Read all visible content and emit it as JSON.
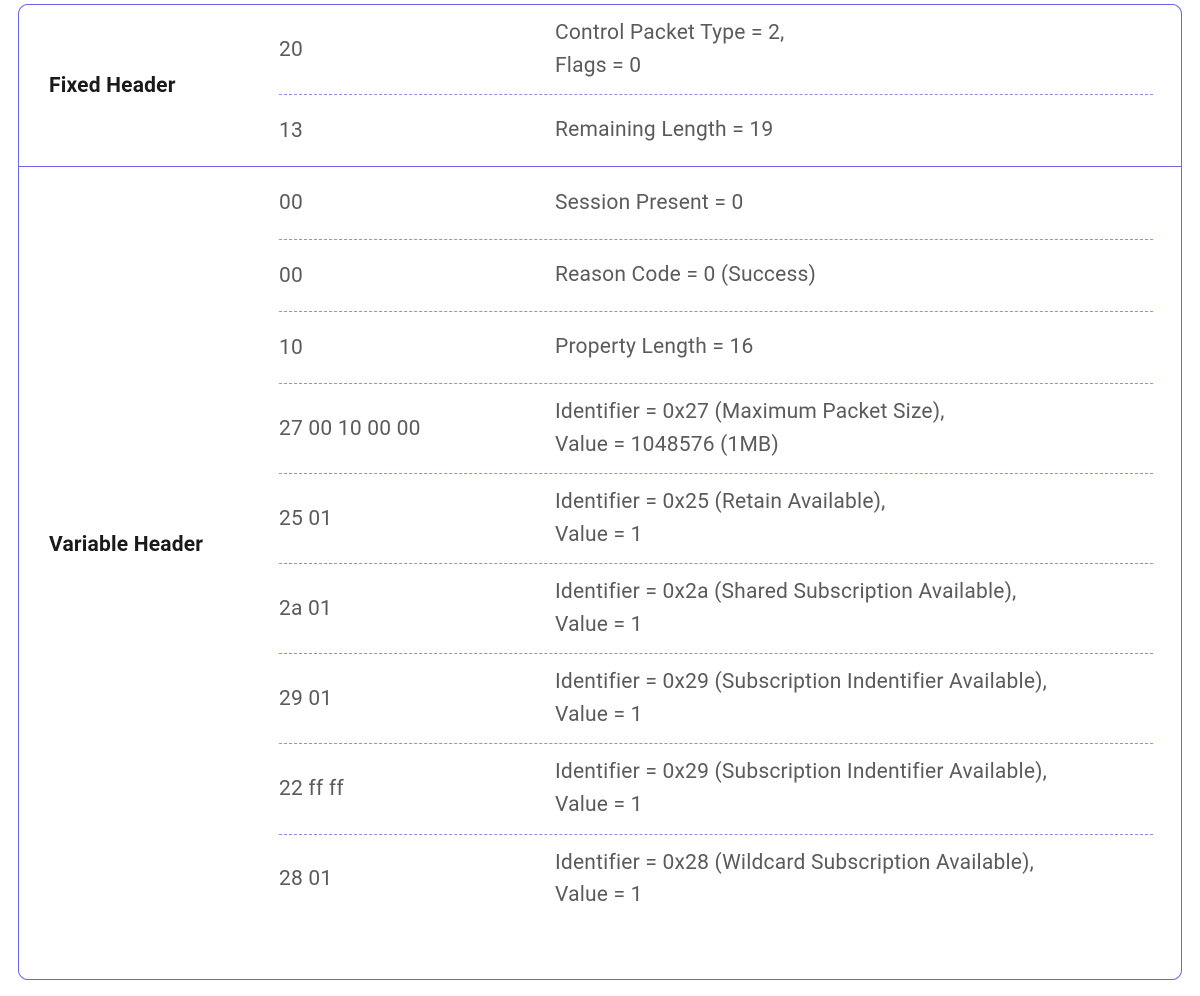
{
  "sections": [
    {
      "label": "Fixed Header",
      "rows": [
        {
          "hex": "20",
          "desc": "Control Packet Type = 2,\nFlags = 0"
        },
        {
          "hex": "13",
          "desc": "Remaining Length = 19"
        }
      ]
    },
    {
      "label": "Variable Header",
      "rows": [
        {
          "hex": "00",
          "desc": "Session Present = 0"
        },
        {
          "hex": "00",
          "desc": "Reason Code = 0 (Success)"
        },
        {
          "hex": "10",
          "desc": "Property Length = 16"
        },
        {
          "hex": "27 00 10 00 00",
          "desc": "Identifier = 0x27 (Maximum Packet Size),\nValue = 1048576 (1MB)"
        },
        {
          "hex": "25 01",
          "desc": "Identifier = 0x25 (Retain Available),\nValue = 1"
        },
        {
          "hex": "2a 01",
          "desc": "Identifier = 0x2a (Shared Subscription Available),\nValue = 1"
        },
        {
          "hex": "29 01",
          "desc": "Identifier = 0x29 (Subscription Indentifier Available),\nValue = 1"
        },
        {
          "hex": "22 ff ff",
          "desc": "Identifier = 0x29 (Subscription Indentifier Available),\nValue = 1"
        },
        {
          "hex": "28 01",
          "desc": "Identifier = 0x28 (Wildcard Subscription Available),\nValue = 1"
        }
      ]
    }
  ]
}
